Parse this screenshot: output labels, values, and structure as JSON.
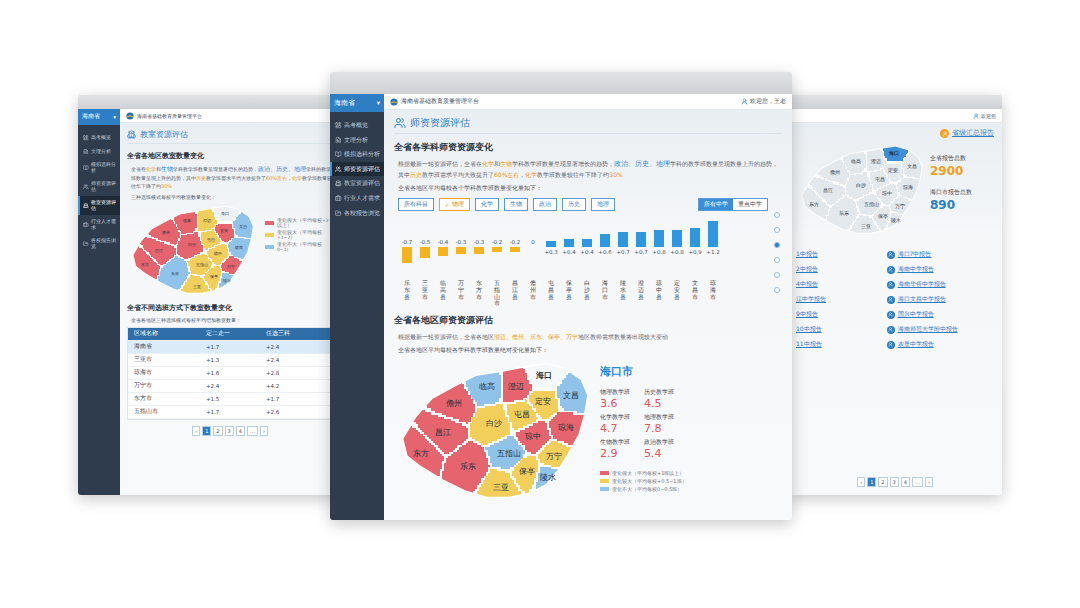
{
  "center_window": {
    "nav": {
      "province": "海南省",
      "dropdown_icon": "▾",
      "items": [
        {
          "label": "高考概览",
          "selected": false
        },
        {
          "label": "文理分析",
          "selected": false
        },
        {
          "label": "模拟选科分析",
          "selected": false
        },
        {
          "label": "师资资源评估",
          "selected": true
        },
        {
          "label": "教室资源评估",
          "selected": false
        },
        {
          "label": "行业人才需求",
          "selected": false
        },
        {
          "label": "各校报告浏览",
          "selected": false
        }
      ]
    },
    "top_bar": {
      "platform": "海南省基础教育质量管理平台",
      "user": "欢迎您，王老"
    },
    "page_title": "师资资源评估",
    "subject_section": {
      "title": "全省各学科师资资源变化",
      "summary": [
        {
          "text": "根据最新一轮资源评估，全省在",
          "kind": "plain"
        },
        {
          "text": "化学",
          "kind": "orange"
        },
        {
          "text": "和",
          "kind": "plain"
        },
        {
          "text": "生物",
          "kind": "orange"
        },
        {
          "text": "学科教学班数量呈现显著增长的趋势，",
          "kind": "plain"
        },
        {
          "text": "政治、历史、地理",
          "kind": "blue"
        },
        {
          "text": "学科的教学班数量呈现数量上升的趋势，其中",
          "kind": "plain"
        },
        {
          "text": "历史",
          "kind": "orange"
        },
        {
          "text": "教学班需求平均大致提升了",
          "kind": "plain"
        },
        {
          "text": "60%左右",
          "kind": "orange"
        },
        {
          "text": "，",
          "kind": "plain"
        },
        {
          "text": "化学",
          "kind": "orange"
        },
        {
          "text": "教学班数量较往年下降了约",
          "kind": "plain"
        },
        {
          "text": "30%",
          "kind": "orange"
        }
      ],
      "caption": "全省各地区平均每校各个学科教学班数量变化量如下：",
      "check_icon": "✓",
      "subject_filters": [
        {
          "label": "所有科目",
          "selected": false
        },
        {
          "label": "物理",
          "selected": true
        },
        {
          "label": "化学",
          "selected": false
        },
        {
          "label": "生物",
          "selected": false
        },
        {
          "label": "政治",
          "selected": false
        },
        {
          "label": "历史",
          "selected": false
        },
        {
          "label": "地理",
          "selected": false
        }
      ],
      "school_toggle": [
        {
          "label": "所有中学",
          "selected": true
        },
        {
          "label": "重点中学",
          "selected": false
        }
      ],
      "chart": {
        "categories": [
          "乐东县",
          "三亚市",
          "临高县",
          "万宁市",
          "东方市",
          "五指山市",
          "昌江县",
          "儋州市",
          "屯昌县",
          "保亭县",
          "白沙县",
          "海口市",
          "陵水县",
          "澄迈县",
          "琼中县",
          "定安县",
          "文昌市",
          "琼海市"
        ],
        "values": [
          -0.7,
          -0.5,
          -0.4,
          -0.3,
          -0.3,
          -0.2,
          -0.2,
          0,
          0.3,
          0.4,
          0.4,
          0.6,
          0.7,
          0.7,
          0.8,
          0.8,
          0.9,
          1.2
        ],
        "value_labels": [
          "-0.7",
          "-0.5",
          "-0.4",
          "-0.3",
          "-0.3",
          "-0.2",
          "-0.2",
          "0",
          "+0.3",
          "+0.4",
          "+0.4",
          "+0.6",
          "+0.7",
          "+0.7",
          "+0.8",
          "+0.8",
          "+0.9",
          "+1.2"
        ]
      },
      "pager_dots": [
        {
          "selected": false
        },
        {
          "selected": false
        },
        {
          "selected": true
        },
        {
          "selected": false
        },
        {
          "selected": false
        },
        {
          "selected": false
        }
      ]
    },
    "region_section": {
      "title": "全省各地区师资资源评估",
      "summary": [
        {
          "text": "根据最新一轮资源评估，全省各地区",
          "kind": "plain"
        },
        {
          "text": "澄迈、儋州、乐东、保亭、万宁",
          "kind": "orange"
        },
        {
          "text": "地区教师需求数量将出现较大变动",
          "kind": "plain"
        }
      ],
      "caption": "全省各地区平均每校各学科教学班数量绝对变化量如下：",
      "map": {
        "regions": [
          {
            "name": "海口",
            "color": "#f4f8fb",
            "selected": true
          },
          {
            "name": "文昌",
            "color": "#8fc3ea",
            "selected": false
          },
          {
            "name": "澄迈",
            "color": "#e5646d",
            "selected": false
          },
          {
            "name": "临高",
            "color": "#8fc3ea",
            "selected": false
          },
          {
            "name": "儋州",
            "color": "#e5646d",
            "selected": false
          },
          {
            "name": "定安",
            "color": "#f2cf5b",
            "selected": false
          },
          {
            "name": "屯昌",
            "color": "#f2cf5b",
            "selected": false
          },
          {
            "name": "琼海",
            "color": "#e5646d",
            "selected": false
          },
          {
            "name": "琼中",
            "color": "#e5646d",
            "selected": false
          },
          {
            "name": "白沙",
            "color": "#f2cf5b",
            "selected": false
          },
          {
            "name": "昌江",
            "color": "#e5646d",
            "selected": false
          },
          {
            "name": "东方",
            "color": "#e5646d",
            "selected": false
          },
          {
            "name": "万宁",
            "color": "#f2cf5b",
            "selected": false
          },
          {
            "name": "五指山",
            "color": "#8fc3ea",
            "selected": false
          },
          {
            "name": "乐东",
            "color": "#e5646d",
            "selected": false
          },
          {
            "name": "保亭",
            "color": "#f2cf5b",
            "selected": false
          },
          {
            "name": "陵水",
            "color": "#8fc3ea",
            "selected": false
          },
          {
            "name": "三亚",
            "color": "#f2cf5b",
            "selected": false
          }
        ]
      },
      "legend": [
        {
          "label": "变化很大（平均每校+1班以上）",
          "color": "#e5646d"
        },
        {
          "label": "变化较大（平均每校+0.5~1班）",
          "color": "#f2cf5b"
        },
        {
          "label": "变化不大（平均每校0~0.5班）",
          "color": "#8fc3ea"
        }
      ],
      "detail": {
        "title": "海口市",
        "stats": [
          {
            "label": "物理教学班",
            "value": "3.6"
          },
          {
            "label": "历史教学班",
            "value": "4.5"
          },
          {
            "label": "化学教学班",
            "value": "4.7"
          },
          {
            "label": "地理教学班",
            "value": "7.8"
          },
          {
            "label": "生物教学班",
            "value": "2.9"
          },
          {
            "label": "政治教学班",
            "value": "5.4"
          }
        ]
      }
    }
  },
  "left_window": {
    "nav": {
      "province": "海南省",
      "dropdown_icon": "▾",
      "items": [
        {
          "label": "高考概览",
          "selected": false
        },
        {
          "label": "文理分析",
          "selected": false
        },
        {
          "label": "模拟选科分析",
          "selected": false
        },
        {
          "label": "师资资源评估",
          "selected": false
        },
        {
          "label": "教室资源评估",
          "selected": true
        },
        {
          "label": "行业人才需求",
          "selected": false
        },
        {
          "label": "各校报告浏览",
          "selected": false
        }
      ]
    },
    "top_bar": {
      "platform": "海南省基础教育质量管理平台"
    },
    "page_title": "教室资源评估",
    "region_section": {
      "title": "全省各地区教室数量变化",
      "summary": [
        {
          "text": "全省在",
          "kind": "plain"
        },
        {
          "text": "化学",
          "kind": "orange"
        },
        {
          "text": "和",
          "kind": "plain"
        },
        {
          "text": "生物",
          "kind": "blue"
        },
        {
          "text": "学科教学班数量呈现显著增长的趋势，",
          "kind": "plain"
        },
        {
          "text": "政治、历史、地理",
          "kind": "blue"
        },
        {
          "text": "学科的教学班数量呈现上升的趋势，其中",
          "kind": "plain"
        },
        {
          "text": "历史",
          "kind": "orange"
        },
        {
          "text": "教学班需求平均大致提升了",
          "kind": "plain"
        },
        {
          "text": "60%左右",
          "kind": "orange"
        },
        {
          "text": "，",
          "kind": "plain"
        },
        {
          "text": "化学",
          "kind": "orange"
        },
        {
          "text": "教学班数量较往年下降了约",
          "kind": "plain"
        },
        {
          "text": "30%",
          "kind": "orange"
        }
      ],
      "caption": "三种选班模式每校平均教室数量变化：",
      "map": {
        "regions": [
          {
            "name": "海口",
            "color": "#eef1f4",
            "selected": false
          },
          {
            "name": "文昌",
            "color": "#8fc3ea",
            "selected": false
          },
          {
            "name": "澄迈",
            "color": "#f2cf5b",
            "selected": false
          },
          {
            "name": "临高",
            "color": "#e5646d",
            "selected": false
          },
          {
            "name": "儋州",
            "color": "#e5646d",
            "selected": false
          },
          {
            "name": "定安",
            "color": "#e5646d",
            "selected": false
          },
          {
            "name": "屯昌",
            "color": "#f2cf5b",
            "selected": false
          },
          {
            "name": "琼海",
            "color": "#8fc3ea",
            "selected": false
          },
          {
            "name": "琼中",
            "color": "#f2cf5b",
            "selected": false
          },
          {
            "name": "白沙",
            "color": "#e5646d",
            "selected": false
          },
          {
            "name": "昌江",
            "color": "#e5646d",
            "selected": false
          },
          {
            "name": "东方",
            "color": "#e5646d",
            "selected": false
          },
          {
            "name": "万宁",
            "color": "#e5646d",
            "selected": false
          },
          {
            "name": "五指山",
            "color": "#f2cf5b",
            "selected": false
          },
          {
            "name": "乐东",
            "color": "#8fc3ea",
            "selected": false
          },
          {
            "name": "保亭",
            "color": "#f2cf5b",
            "selected": false
          },
          {
            "name": "陵水",
            "color": "#8fc3ea",
            "selected": false
          },
          {
            "name": "三亚",
            "color": "#f2cf5b",
            "selected": false
          }
        ]
      },
      "legend": [
        {
          "label": "变化很大（平均每校+2以上）",
          "color": "#e5646d"
        },
        {
          "label": "变化较大（平均每校+1~2）",
          "color": "#f2cf5b"
        },
        {
          "label": "变化不大（平均每校0~1）",
          "color": "#8fc3ea"
        }
      ]
    },
    "mode_section": {
      "title": "全省不同选班方式下教室数量变化",
      "caption": "全省各地区三种选班模式每校平均增加教室数量：",
      "table": {
        "columns": [
          "区域名称",
          "定二走一",
          "任选三科"
        ],
        "rows": [
          {
            "cells": [
              "海南省",
              "+1.7",
              "+2.4"
            ],
            "selected": true
          },
          {
            "cells": [
              "三亚市",
              "+1.3",
              "+2.4"
            ],
            "selected": false
          },
          {
            "cells": [
              "琼海市",
              "+1.6",
              "+2.8"
            ],
            "selected": false
          },
          {
            "cells": [
              "万宁市",
              "+2.4",
              "+4.2"
            ],
            "selected": false
          },
          {
            "cells": [
              "东方市",
              "+1.5",
              "+1.7"
            ],
            "selected": false
          },
          {
            "cells": [
              "五指山市",
              "+1.7",
              "+2.6"
            ],
            "selected": false
          }
        ]
      },
      "pagination": [
        {
          "label": "‹",
          "selected": false
        },
        {
          "label": "1",
          "selected": true
        },
        {
          "label": "2",
          "selected": false
        },
        {
          "label": "3",
          "selected": false
        },
        {
          "label": "4",
          "selected": false
        },
        {
          "label": "…",
          "selected": false
        },
        {
          "label": "›",
          "selected": false
        }
      ]
    }
  },
  "right_window": {
    "top_bar": {
      "user": "欢迎您"
    },
    "summary_link": "省级汇总报告",
    "map": {
      "regions": [
        {
          "name": "海口",
          "color": "#3f8fd8",
          "selected": true
        },
        {
          "name": "文昌",
          "color": "#e3e8ed",
          "selected": false
        },
        {
          "name": "澄迈",
          "color": "#e3e8ed",
          "selected": false
        },
        {
          "name": "临高",
          "color": "#e3e8ed",
          "selected": false
        },
        {
          "name": "儋州",
          "color": "#e3e8ed",
          "selected": false
        },
        {
          "name": "定安",
          "color": "#e3e8ed",
          "selected": false
        },
        {
          "name": "屯昌",
          "color": "#e3e8ed",
          "selected": false
        },
        {
          "name": "琼海",
          "color": "#e3e8ed",
          "selected": false
        },
        {
          "name": "琼中",
          "color": "#e3e8ed",
          "selected": false
        },
        {
          "name": "白沙",
          "color": "#e3e8ed",
          "selected": false
        },
        {
          "name": "昌江",
          "color": "#e3e8ed",
          "selected": false
        },
        {
          "name": "东方",
          "color": "#e3e8ed",
          "selected": false
        },
        {
          "name": "万宁",
          "color": "#e3e8ed",
          "selected": false
        },
        {
          "name": "五指山",
          "color": "#e3e8ed",
          "selected": false
        },
        {
          "name": "乐东",
          "color": "#e3e8ed",
          "selected": false
        },
        {
          "name": "保亭",
          "color": "#e3e8ed",
          "selected": false
        },
        {
          "name": "陵水",
          "color": "#e3e8ed",
          "selected": false
        },
        {
          "name": "三亚",
          "color": "#e3e8ed",
          "selected": false
        }
      ]
    },
    "totals": [
      {
        "label": "全省报告总数",
        "value": "2900",
        "color": "#f0a020"
      },
      {
        "label": "海口市报告总数",
        "value": "890",
        "color": "#2b7fc7"
      }
    ],
    "reports_left": [
      "1中报告",
      "2中报告",
      "4中报告",
      "江中学报告",
      "9中报告",
      "10中报告",
      "11中报告"
    ],
    "reports_right": [
      "海口7中报告",
      "海南中学报告",
      "海南华侨中学报告",
      "海口文昌中学报告",
      "国兴中学报告",
      "海南师范大学附中报告",
      "农垦中学报告"
    ],
    "pagination": [
      {
        "label": "‹",
        "selected": false
      },
      {
        "label": "1",
        "selected": true
      },
      {
        "label": "2",
        "selected": false
      },
      {
        "label": "3",
        "selected": false
      },
      {
        "label": "4",
        "selected": false
      },
      {
        "label": "…",
        "selected": false
      },
      {
        "label": "›",
        "selected": false
      }
    ]
  }
}
